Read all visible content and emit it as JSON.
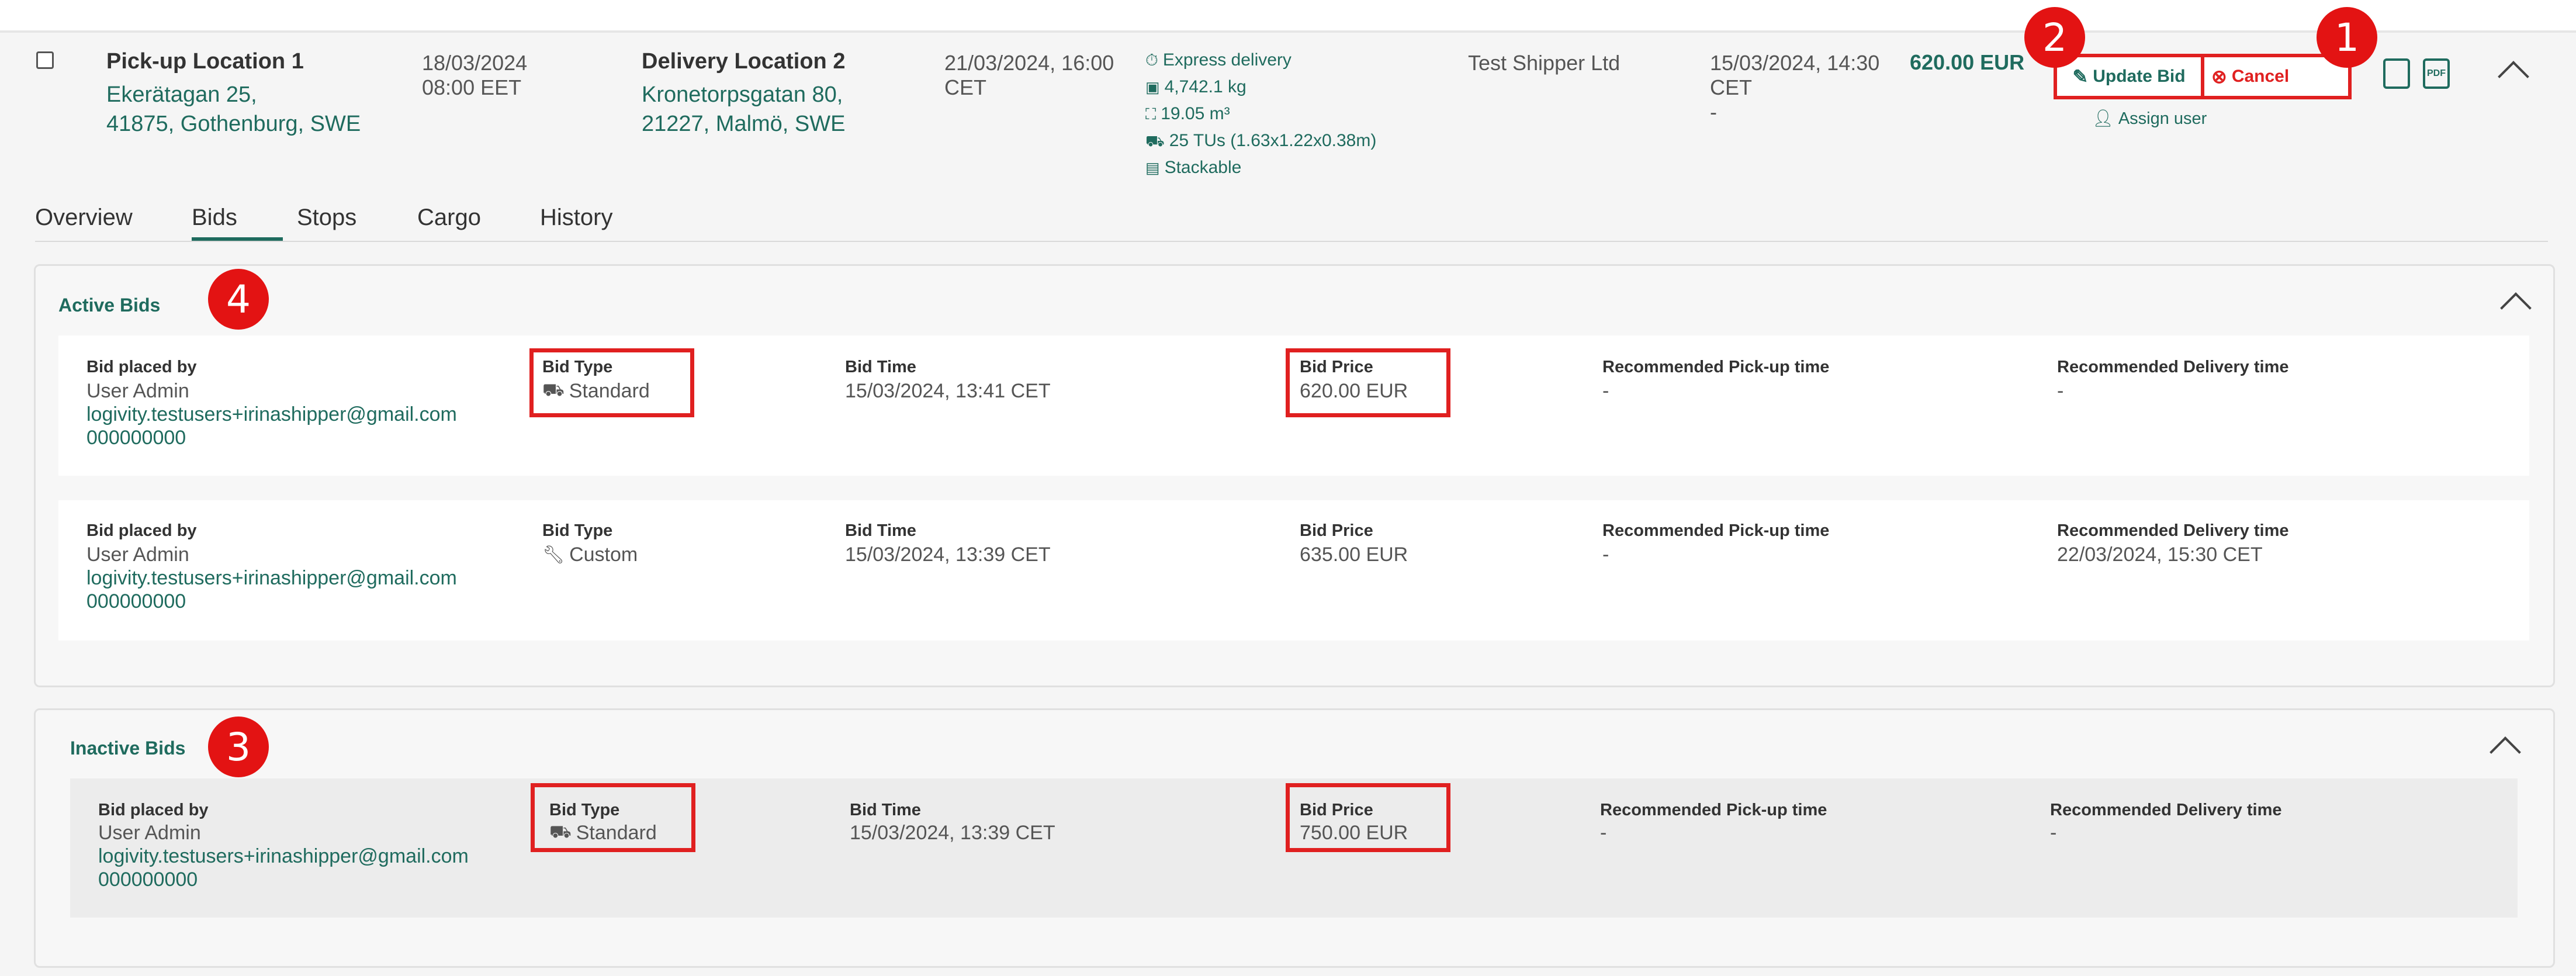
{
  "shipment": {
    "pickup": {
      "title": "Pick-up Location 1",
      "line1": "Ekerätagan 25,",
      "line2": "41875, Gothenburg, SWE",
      "date": "18/03/2024",
      "time": "08:00 EET"
    },
    "delivery": {
      "title": "Delivery Location 2",
      "line1": "Kronetorpsgatan 80,",
      "line2": "21227, Malmö, SWE",
      "date": "21/03/2024, 16:00",
      "tz": "CET"
    },
    "details": [
      "Express delivery",
      "4,742.1 kg",
      "19.05 m³",
      "25 TUs (1.63x1.22x0.38m)",
      "Stackable"
    ],
    "shipper": "Test Shipper Ltd",
    "created_line1": "15/03/2024, 14:30",
    "created_line2": "CET",
    "created_line3": "-",
    "price": "620.00 EUR",
    "update_bid_label": "Update Bid",
    "cancel_label": "Cancel",
    "assign_user_label": "Assign user"
  },
  "badges": {
    "b1": "1",
    "b2": "2",
    "b3": "3",
    "b4": "4"
  },
  "tabs": [
    {
      "label": "Overview"
    },
    {
      "label": "Bids"
    },
    {
      "label": "Stops"
    },
    {
      "label": "Cargo"
    },
    {
      "label": "History"
    }
  ],
  "labels": {
    "placed_by": "Bid placed by",
    "bid_type": "Bid Type",
    "bid_time": "Bid Time",
    "bid_price": "Bid Price",
    "rec_pickup": "Recommended Pick-up time",
    "rec_delivery": "Recommended Delivery time"
  },
  "active": {
    "title": "Active Bids",
    "bids": [
      {
        "user": "User Admin",
        "email": "logivity.testusers+irinashipper@gmail.com",
        "phone": "000000000",
        "type": "Standard",
        "time": "15/03/2024, 13:41 CET",
        "price": "620.00 EUR",
        "pickup": "-",
        "delivery": "-"
      },
      {
        "user": "User Admin",
        "email": "logivity.testusers+irinashipper@gmail.com",
        "phone": "000000000",
        "type": "Custom",
        "time": "15/03/2024, 13:39 CET",
        "price": "635.00 EUR",
        "pickup": "-",
        "delivery": "22/03/2024, 15:30 CET"
      }
    ]
  },
  "inactive": {
    "title": "Inactive Bids",
    "bids": [
      {
        "user": "User Admin",
        "email": "logivity.testusers+irinashipper@gmail.com",
        "phone": "000000000",
        "type": "Standard",
        "time": "15/03/2024, 13:39 CET",
        "price": "750.00 EUR",
        "pickup": "-",
        "delivery": "-"
      }
    ]
  },
  "colors": {
    "accent": "#1f6b5e",
    "highlight": "#e02020",
    "badge": "#e31313"
  }
}
